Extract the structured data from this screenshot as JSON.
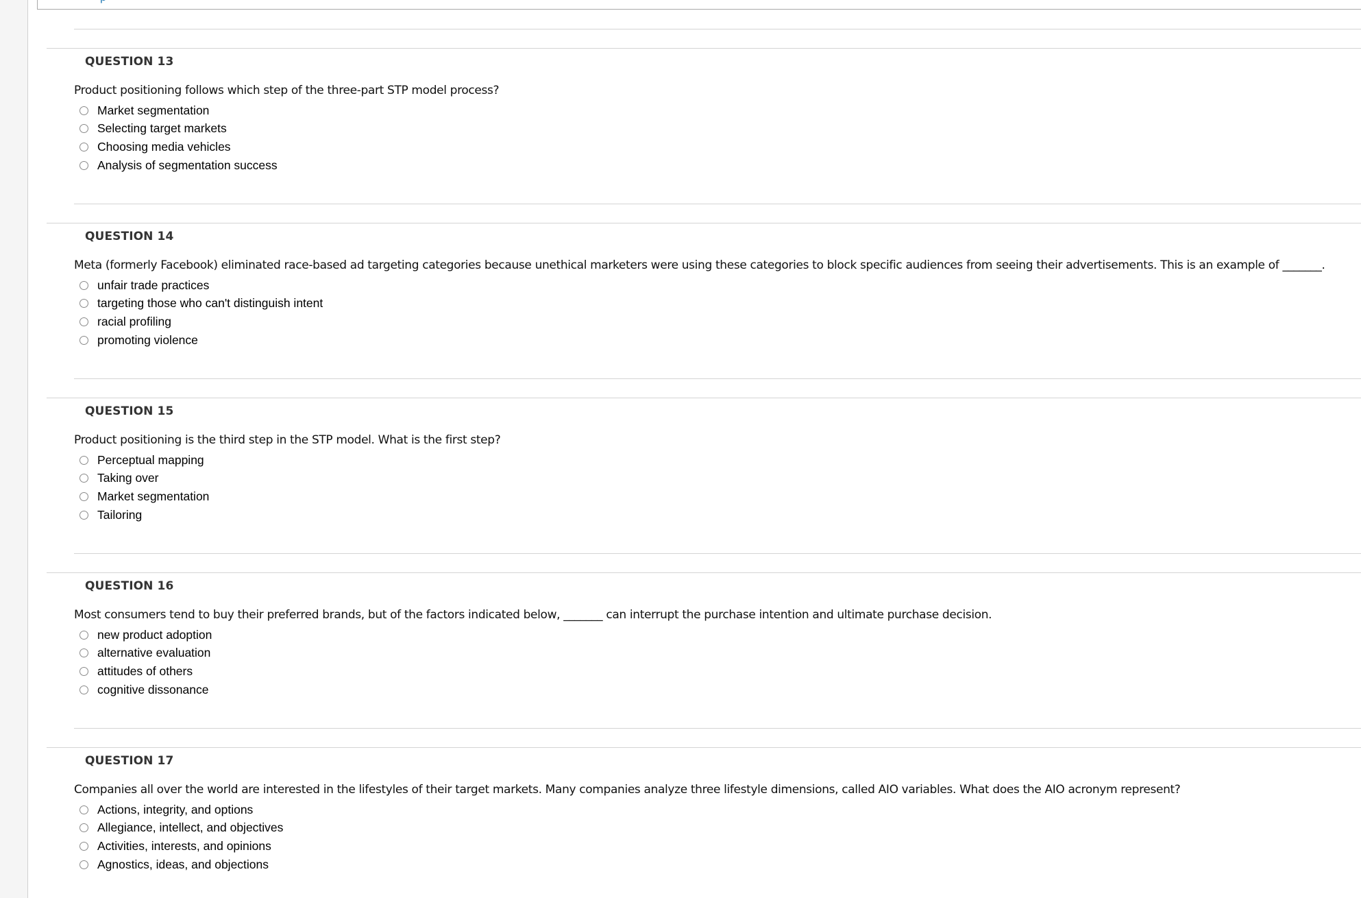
{
  "top_section": {
    "partial_link_text": "ρ"
  },
  "questions": [
    {
      "heading": "QUESTION 13",
      "text": "Product positioning follows which step of the three-part STP model process?",
      "options": [
        "Market segmentation",
        "Selecting target markets",
        "Choosing media vehicles",
        "Analysis of segmentation success"
      ],
      "selected": null
    },
    {
      "heading": "QUESTION 14",
      "text": "Meta (formerly Facebook) eliminated race-based ad targeting categories because unethical marketers were using these categories to block specific audiences from seeing their advertisements. This is an example of _______.",
      "options": [
        "unfair trade practices",
        "targeting those who can't distinguish intent",
        "racial profiling",
        "promoting violence"
      ],
      "selected": null
    },
    {
      "heading": "QUESTION 15",
      "text": "Product positioning is the third step in the STP model. What is the first step?",
      "options": [
        "Perceptual mapping",
        "Taking over",
        "Market segmentation",
        "Tailoring"
      ],
      "selected": null
    },
    {
      "heading": "QUESTION 16",
      "text": "Most consumers tend to buy their preferred brands, but of the factors indicated below, _______ can interrupt the purchase intention and ultimate purchase decision.",
      "options": [
        "new product adoption",
        "alternative evaluation",
        "attitudes of others",
        "cognitive dissonance"
      ],
      "selected": null
    },
    {
      "heading": "QUESTION 17",
      "text": "Companies all over the world are interested in the lifestyles of their target markets. Many companies analyze three lifestyle dimensions, called AIO variables. What does the AIO acronym represent?",
      "options": [
        "Actions, integrity, and options",
        "Allegiance, intellect, and objectives",
        "Activities, interests, and opinions",
        "Agnostics, ideas, and objections"
      ],
      "selected": null
    }
  ],
  "colors": {
    "link": "#2a7fb8",
    "heading": "#333333",
    "separator": "#d4d4d4",
    "sidebar": "#f5f5f5"
  }
}
